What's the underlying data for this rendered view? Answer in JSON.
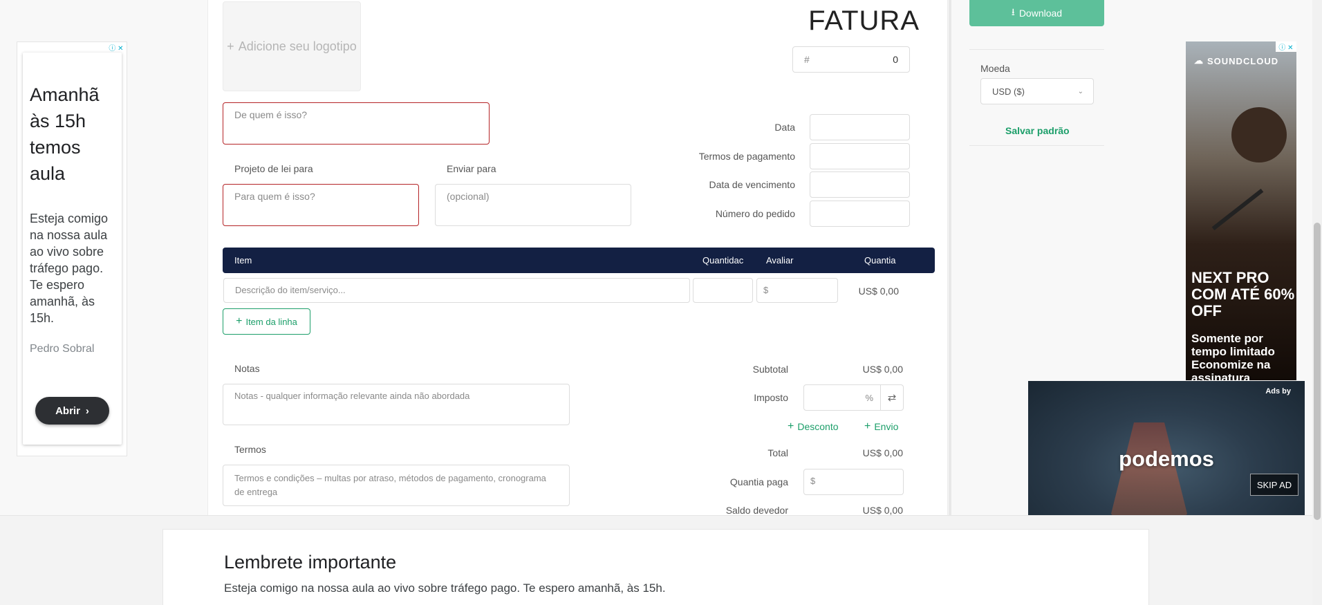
{
  "invoice": {
    "logo_placeholder": "Adicione seu logotipo",
    "title": "FATURA",
    "number_hash": "#",
    "number_value": "0",
    "from_placeholder": "De quem é isso?",
    "bill_to_label": "Projeto de lei para",
    "bill_to_placeholder": "Para quem é isso?",
    "ship_to_label": "Enviar para",
    "ship_to_placeholder": "(opcional)",
    "date_label": "Data",
    "payment_terms_label": "Termos de pagamento",
    "due_date_label": "Data de vencimento",
    "po_number_label": "Número do pedido",
    "table": {
      "col_item": "Item",
      "col_quantity": "Quantidac",
      "col_rate": "Avaliar",
      "col_amount": "Quantia",
      "row_description_placeholder": "Descrição do item/serviço...",
      "row_rate_prefix": "$",
      "row_amount": "US$ 0,00",
      "add_line_label": "Item da linha"
    },
    "notes_label": "Notas",
    "notes_placeholder": "Notas - qualquer informação relevante ainda não abordada",
    "terms_label": "Termos",
    "terms_placeholder": "Termos e condições – multas por atraso, métodos de pagamento, cronograma de entrega",
    "subtotal_label": "Subtotal",
    "subtotal_value": "US$ 0,00",
    "tax_label": "Imposto",
    "tax_suffix": "%",
    "discount_label": "Desconto",
    "shipping_label": "Envio",
    "total_label": "Total",
    "total_value": "US$ 0,00",
    "amount_paid_label": "Quantia paga",
    "amount_paid_prefix": "$",
    "balance_due_label": "Saldo devedor",
    "balance_due_value": "US$ 0,00"
  },
  "sidebar": {
    "download_label": "Download",
    "currency_label": "Moeda",
    "currency_value": "USD ($)",
    "save_default_label": "Salvar padrão"
  },
  "left_ad": {
    "heading": "Amanhã às 15h temos aula",
    "body": "Esteja comigo na nossa aula ao vivo sobre tráfego pago. Te espero amanhã, às 15h.",
    "author": "Pedro Sobral",
    "button": "Abrir"
  },
  "right_ad": {
    "brand": "SOUNDCLOUD",
    "headline": "NEXT PRO COM ATÉ 60% OFF",
    "subline": "Somente por tempo limitado Economize na assinatura"
  },
  "video_ad": {
    "ads_by": "Ads by",
    "text": "podemos",
    "skip": "SKIP AD"
  },
  "bottom_banner": {
    "title": "Lembrete importante",
    "text": "Esteja comigo na nossa aula ao vivo sobre tráfego pago. Te espero amanhã, às 15h."
  },
  "colors": {
    "accent_green": "#1b9e69",
    "download_green": "#5dc09a",
    "table_header": "#132043",
    "error_border": "#b42326"
  }
}
